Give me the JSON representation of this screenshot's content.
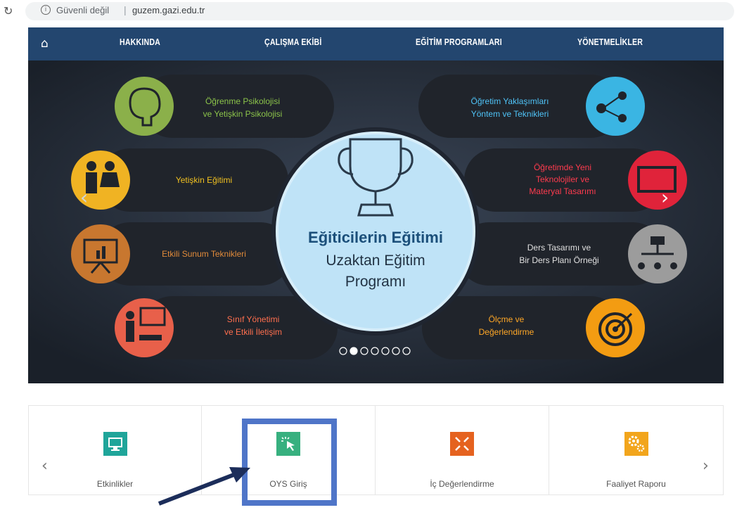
{
  "browser": {
    "security_text": "Güvenli değil",
    "separator": "|",
    "url": "guzem.gazi.edu.tr"
  },
  "nav": {
    "items": [
      {
        "label": "HAKKINDA"
      },
      {
        "label": "ÇALIŞMA EKİBİ"
      },
      {
        "label": "EĞİTİM PROGRAMLARI"
      },
      {
        "label": "YÖNETMELİKLER"
      }
    ]
  },
  "slider": {
    "center_title": "Eğiticilerin Eğitimi",
    "center_sub1": "Uzaktan Eğitim",
    "center_sub2": "Programı",
    "left_items": [
      {
        "line1": "Öğrenme Psikolojisi",
        "line2": "ve Yetişkin Psikolojisi",
        "color": "#8bb04a",
        "icon": "brain-icon"
      },
      {
        "line1": "Yetişkin Eğitimi",
        "line2": "",
        "color": "#f0b323",
        "icon": "adults-icon"
      },
      {
        "line1": "Etkili Sunum Teknikleri",
        "line2": "",
        "color": "#c8772f",
        "icon": "presentation-icon"
      },
      {
        "line1": "Sınıf Yönetimi",
        "line2": "ve Etkili İletişim",
        "color": "#e8604a",
        "icon": "classroom-icon"
      }
    ],
    "right_items": [
      {
        "line1": "Öğretim Yaklaşımları",
        "line2": "Yöntem ve Teknikleri",
        "line3": "",
        "color": "#3ab5e3",
        "icon": "share-icon"
      },
      {
        "line1": "Öğretimde Yeni",
        "line2": "Teknolojiler ve",
        "line3": "Materyal Tasarımı",
        "color": "#e0233a",
        "icon": "monitor-icon"
      },
      {
        "line1": "Ders Tasarımı ve",
        "line2": "Bir Ders Planı Örneği",
        "line3": "",
        "color": "#9c9c9c",
        "icon": "hierarchy-icon"
      },
      {
        "line1": "Ölçme ve",
        "line2": "Değerlendirme",
        "line3": "",
        "color": "#f39c12",
        "icon": "target-icon"
      }
    ],
    "dots_total": 7,
    "dots_active": 2
  },
  "tiles": [
    {
      "label": "Etkinlikler",
      "color": "#1fa59a",
      "icon": "monitor-icon"
    },
    {
      "label": "OYS Giriş",
      "color": "#37b07f",
      "icon": "click-icon"
    },
    {
      "label": "İç Değerlendirme",
      "color": "#e5621f",
      "icon": "collapse-icon"
    },
    {
      "label": "Faaliyet Raporu",
      "color": "#f2a51c",
      "icon": "gears-icon"
    }
  ],
  "colors": {
    "nav_bg": "#23466f",
    "banner_bg": "#1f2530",
    "center_circle": "#bfe3f7",
    "highlight": "#4f75c8",
    "arrow": "#1c2d5a"
  }
}
